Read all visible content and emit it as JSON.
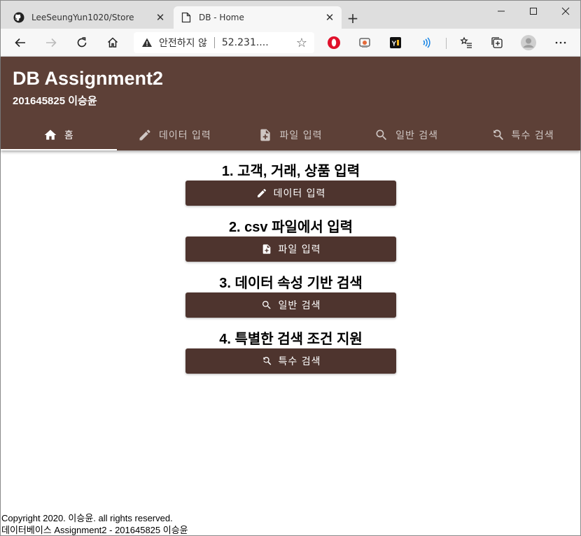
{
  "browser": {
    "tabs": [
      {
        "title": "LeeSeungYun1020/Store",
        "favicon": "github-icon",
        "active": false
      },
      {
        "title": "DB - Home",
        "favicon": "page-icon",
        "active": true
      }
    ],
    "address": {
      "security_text": "안전하지 않",
      "url": "52.231...."
    }
  },
  "app": {
    "title": "DB Assignment2",
    "subtitle": "201645825 이승윤",
    "header_color": "#5d4037",
    "nav": [
      {
        "label": "홈",
        "icon": "home-icon",
        "active": true
      },
      {
        "label": "데이터 입력",
        "icon": "pencil-icon",
        "active": false
      },
      {
        "label": "파일 입력",
        "icon": "file-add-icon",
        "active": false
      },
      {
        "label": "일반 검색",
        "icon": "search-icon",
        "active": false
      },
      {
        "label": "특수 검색",
        "icon": "search-refresh-icon",
        "active": false
      }
    ]
  },
  "sections": [
    {
      "heading": "1. 고객, 거래, 상품 입력",
      "button_label": "데이터 입력",
      "icon": "pencil-icon"
    },
    {
      "heading": "2. csv 파일에서 입력",
      "button_label": "파일 입력",
      "icon": "file-add-icon"
    },
    {
      "heading": "3. 데이터 속성 기반 검색",
      "button_label": "일반 검색",
      "icon": "search-icon"
    },
    {
      "heading": "4. 특별한 검색 조건 지원",
      "button_label": "특수 검색",
      "icon": "search-refresh-icon"
    }
  ],
  "button_color": "#4e342e",
  "footer": {
    "line1": "Copyright 2020. 이승윤. all rights reserved.",
    "line2": "데이터베이스 Assignment2 - 201645825 이승윤"
  }
}
